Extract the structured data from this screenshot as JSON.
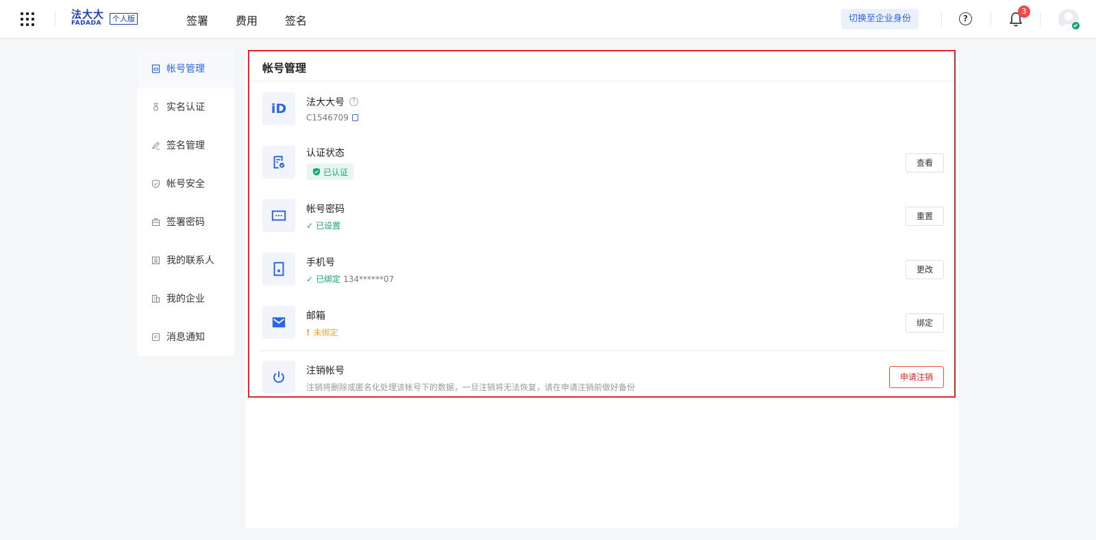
{
  "header": {
    "logo_main": "法大大",
    "logo_sub": "FADADA",
    "logo_badge": "个人版",
    "nav": [
      "签署",
      "费用",
      "签名"
    ],
    "switch_label": "切换至企业身份",
    "help_glyph": "?",
    "notification_count": "3"
  },
  "sidebar": {
    "items": [
      {
        "label": "帐号管理",
        "icon": "account-icon",
        "active": true
      },
      {
        "label": "实名认证",
        "icon": "medal-icon"
      },
      {
        "label": "签名管理",
        "icon": "pen-icon"
      },
      {
        "label": "帐号安全",
        "icon": "shield-icon"
      },
      {
        "label": "签署密码",
        "icon": "briefcase-icon"
      },
      {
        "label": "我的联系人",
        "icon": "contact-icon"
      },
      {
        "label": "我的企业",
        "icon": "building-icon"
      },
      {
        "label": "消息通知",
        "icon": "notice-icon"
      }
    ]
  },
  "main": {
    "title": "帐号管理",
    "rows": {
      "fadada_id": {
        "label": "法大大号",
        "value": "C1546709",
        "help_glyph": "?",
        "icon_text": "iD"
      },
      "auth": {
        "label": "认证状态",
        "status": "已认证",
        "button": "查看"
      },
      "password": {
        "label": "帐号密码",
        "status": "已设置",
        "button": "重置"
      },
      "phone": {
        "label": "手机号",
        "status": "已绑定",
        "value": "134******07",
        "button": "更改"
      },
      "email": {
        "label": "邮箱",
        "status": "未绑定",
        "button": "绑定"
      },
      "cancel": {
        "label": "注销帐号",
        "desc": "注销将删除或匿名化处理该帐号下的数据，一旦注销将无法恢复，请在申请注销前做好备份",
        "button": "申请注销"
      }
    }
  },
  "colors": {
    "accent": "#2e64e8",
    "success": "#17a673",
    "warning": "#f5a623",
    "danger": "#e62222"
  }
}
